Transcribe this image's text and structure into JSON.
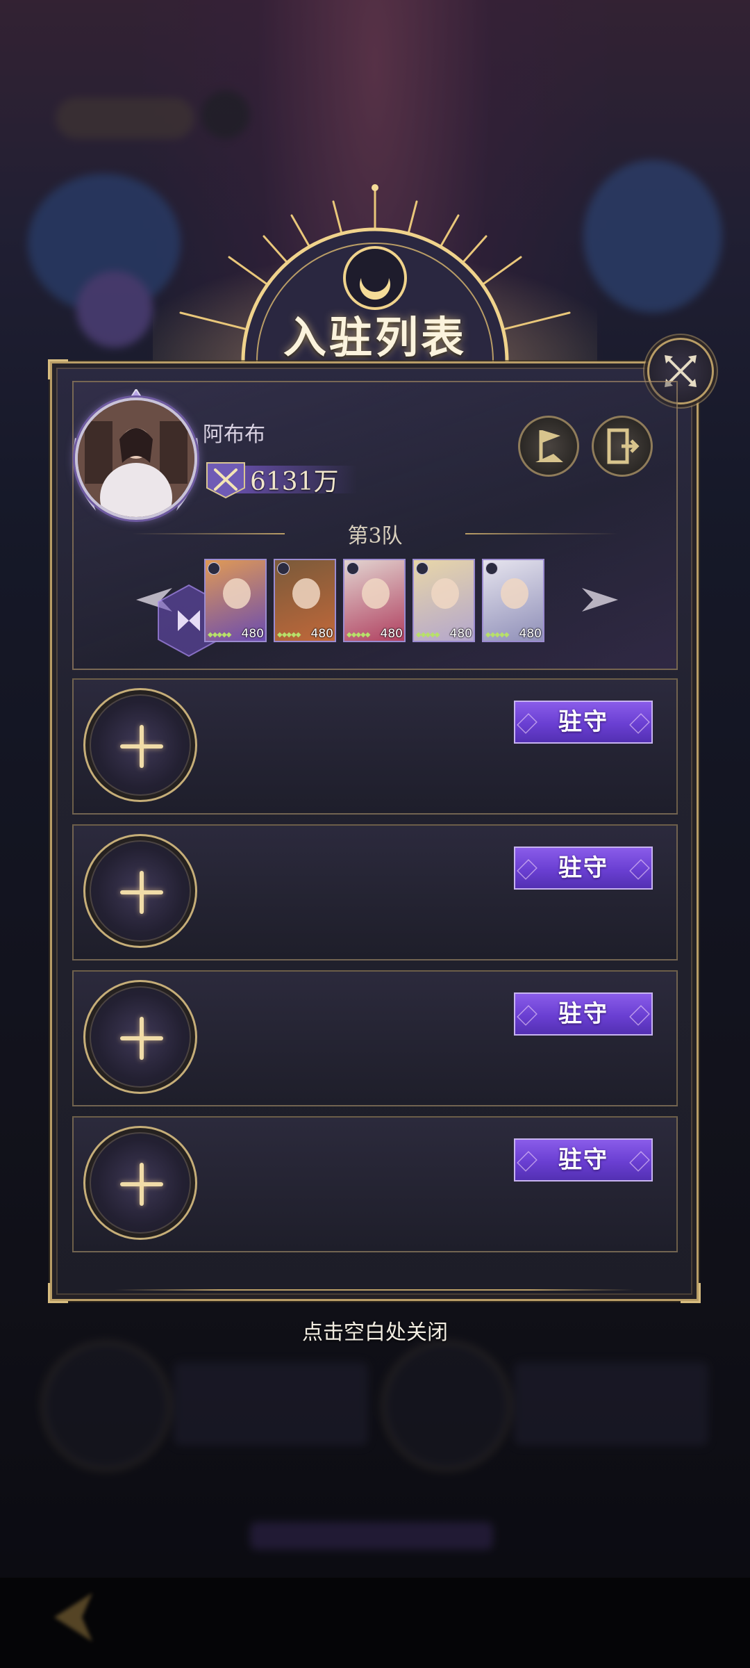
{
  "title": "入驻列表",
  "player": {
    "name": "阿布布",
    "power": "6131万"
  },
  "team": {
    "label": "第3队",
    "heroes": [
      {
        "level": "480",
        "class": "earth",
        "tint": [
          "#e09a55",
          "#6a4bb0"
        ]
      },
      {
        "level": "480",
        "class": "heart",
        "tint": [
          "#7a5a3a",
          "#c0683a"
        ]
      },
      {
        "level": "480",
        "class": "heart",
        "tint": [
          "#e2d4d0",
          "#b04060"
        ]
      },
      {
        "level": "480",
        "class": "mind",
        "tint": [
          "#e8d6a8",
          "#b3a6cc"
        ]
      },
      {
        "level": "480",
        "class": "mind",
        "tint": [
          "#e6e4ee",
          "#8f8fb8"
        ]
      }
    ]
  },
  "slots": [
    {
      "button_label": "驻守"
    },
    {
      "button_label": "驻守"
    },
    {
      "button_label": "驻守"
    },
    {
      "button_label": "驻守"
    }
  ],
  "close_hint": "点击空白处关闭",
  "colors": {
    "gold": "#b99d66",
    "button_purple": "#6a3fd2"
  }
}
